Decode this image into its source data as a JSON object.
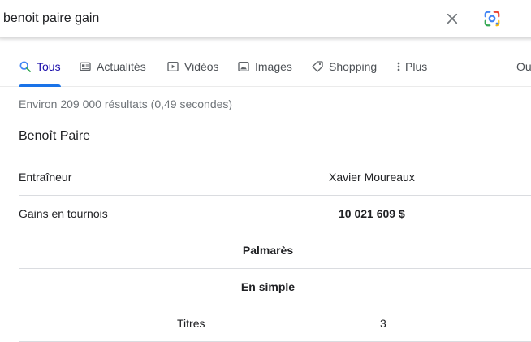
{
  "search": {
    "query": "benoit paire gain"
  },
  "tabs": [
    {
      "label": "Tous",
      "icon": "search-icon",
      "active": true
    },
    {
      "label": "Actualités",
      "icon": "news-icon"
    },
    {
      "label": "Vidéos",
      "icon": "video-icon"
    },
    {
      "label": "Images",
      "icon": "image-icon"
    },
    {
      "label": "Shopping",
      "icon": "tag-icon"
    },
    {
      "label": "Plus",
      "icon": "more-vert-icon"
    },
    {
      "label": "Ou"
    }
  ],
  "result_stats": "Environ 209 000 résultats (0,49 secondes)",
  "knowledge_panel": {
    "title": "Benoît Paire",
    "rows": [
      {
        "label": "Entraîneur",
        "value": "Xavier Moureaux"
      },
      {
        "label": "Gains en tournois",
        "value": "10 021 609 $"
      },
      {
        "heading": "Palmarès"
      },
      {
        "heading": "En simple"
      },
      {
        "label": "Titres",
        "value": "3"
      }
    ]
  },
  "colors": {
    "accent": "#1a73e8",
    "active_tab_text": "#1a0dab",
    "secondary_text": "#70757a"
  }
}
